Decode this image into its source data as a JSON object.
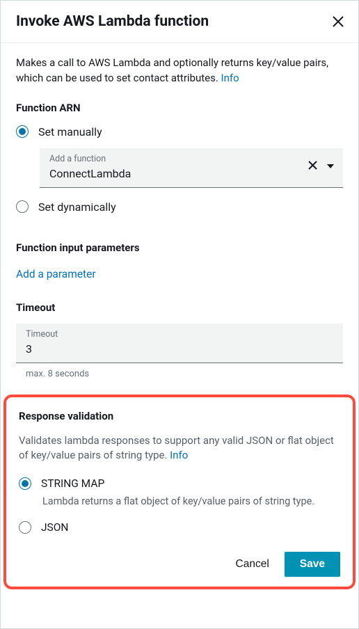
{
  "header": {
    "title": "Invoke AWS Lambda function"
  },
  "description": {
    "text": "Makes a call to AWS Lambda and optionally returns key/value pairs, which can be used to set contact attributes. ",
    "info_label": "Info"
  },
  "function_arn": {
    "title": "Function ARN",
    "set_manually_label": "Set manually",
    "set_dynamically_label": "Set dynamically",
    "dropdown_label": "Add a function",
    "dropdown_value": "ConnectLambda"
  },
  "input_params": {
    "title": "Function input parameters",
    "add_link": "Add a parameter"
  },
  "timeout": {
    "title": "Timeout",
    "field_label": "Timeout",
    "value": "3",
    "helper": "max. 8 seconds"
  },
  "response_validation": {
    "title": "Response validation",
    "desc": "Validates lambda responses to support any valid JSON or flat object of key/value pairs of string type. ",
    "info_label": "Info",
    "string_map_label": "STRING MAP",
    "string_map_sub": "Lambda returns a flat object of key/value pairs of string type.",
    "json_label": "JSON"
  },
  "footer": {
    "cancel": "Cancel",
    "save": "Save"
  }
}
